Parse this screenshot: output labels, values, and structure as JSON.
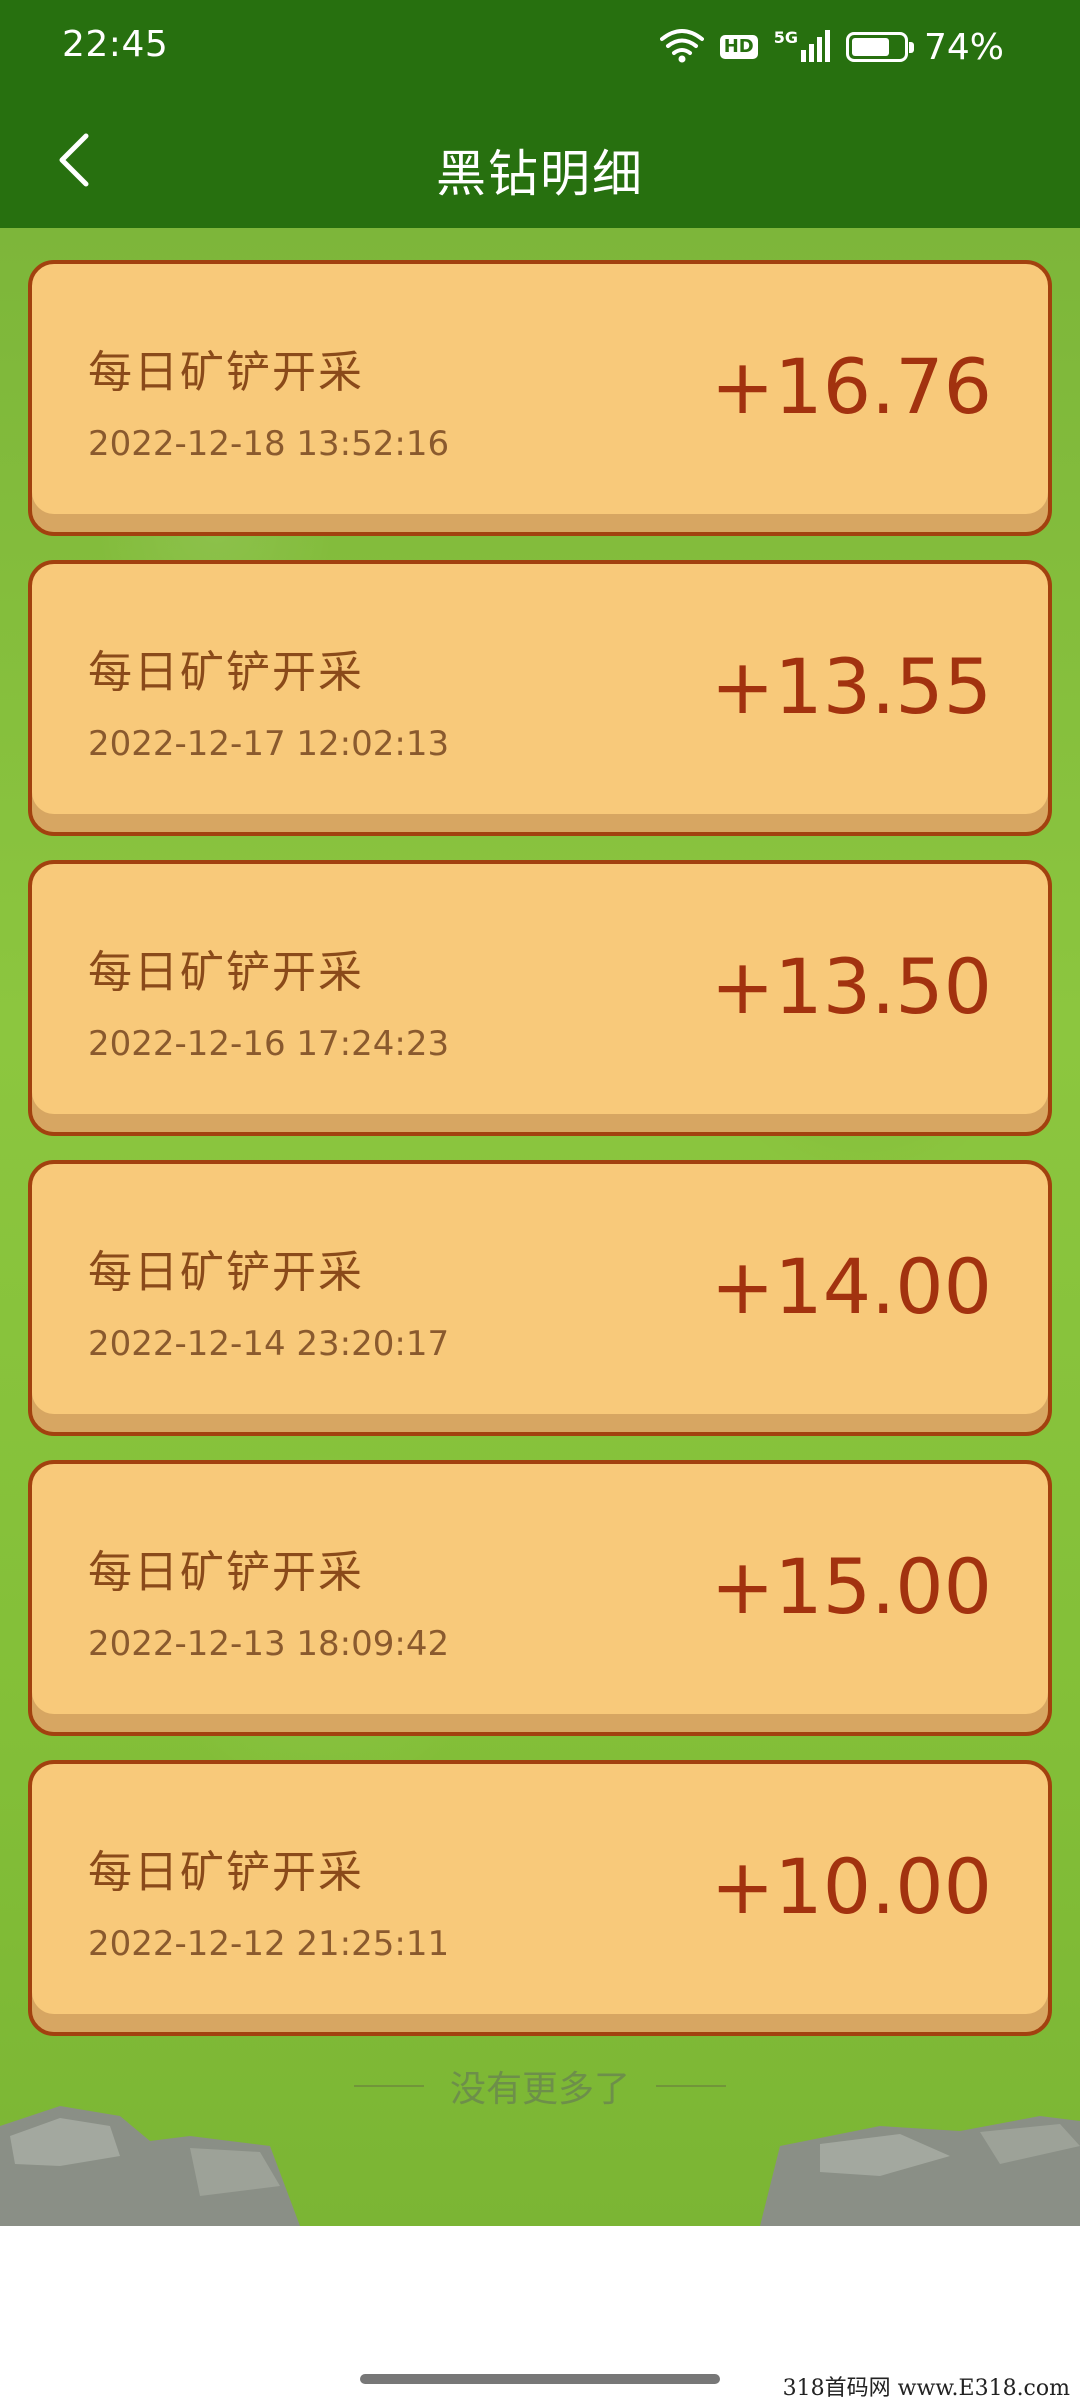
{
  "status": {
    "time": "22:45",
    "hd": "HD",
    "network": "5G",
    "battery_percent": "74%",
    "battery_level": 0.74
  },
  "header": {
    "title": "黑钻明细"
  },
  "records": [
    {
      "title": "每日矿铲开采",
      "time": "2022-12-18 13:52:16",
      "amount": "+16.76"
    },
    {
      "title": "每日矿铲开采",
      "time": "2022-12-17 12:02:13",
      "amount": "+13.55"
    },
    {
      "title": "每日矿铲开采",
      "time": "2022-12-16 17:24:23",
      "amount": "+13.50"
    },
    {
      "title": "每日矿铲开采",
      "time": "2022-12-14 23:20:17",
      "amount": "+14.00"
    },
    {
      "title": "每日矿铲开采",
      "time": "2022-12-13 18:09:42",
      "amount": "+15.00"
    },
    {
      "title": "每日矿铲开采",
      "time": "2022-12-12 21:25:11",
      "amount": "+10.00"
    }
  ],
  "footer": {
    "end_text": "没有更多了"
  },
  "watermark": "318首码网 www.E318.com",
  "colors": {
    "header_green": "#27700f",
    "card_fill": "#f8c97a",
    "card_border": "#a2410f",
    "amount_color": "#a2320f"
  }
}
